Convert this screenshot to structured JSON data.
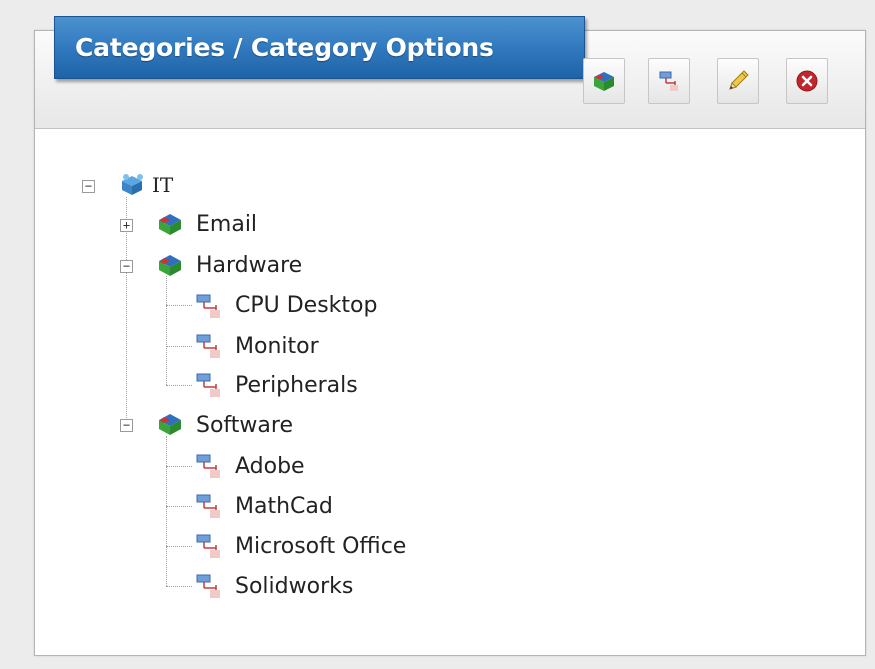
{
  "panel": {
    "title": "Categories / Category Options"
  },
  "toolbar": {
    "buttons": [
      {
        "name": "add-category",
        "icon": "category-cube-icon"
      },
      {
        "name": "add-option",
        "icon": "option-connector-icon"
      },
      {
        "name": "edit",
        "icon": "pencil-icon"
      },
      {
        "name": "delete",
        "icon": "delete-red-x-icon"
      }
    ]
  },
  "tree": {
    "root": {
      "label": "IT",
      "expanded": true,
      "icon": "network-root-icon"
    },
    "categories": [
      {
        "label": "Email",
        "expanded": false,
        "icon": "category-cube-icon",
        "options": []
      },
      {
        "label": "Hardware",
        "expanded": true,
        "icon": "category-cube-icon",
        "options": [
          "CPU Desktop",
          "Monitor",
          "Peripherals"
        ]
      },
      {
        "label": "Software",
        "expanded": true,
        "icon": "category-cube-icon",
        "options": [
          "Adobe",
          "MathCad",
          "Microsoft Office",
          "Solidworks"
        ]
      }
    ],
    "expander_symbols": {
      "expanded": "−",
      "collapsed": "+"
    }
  },
  "colors": {
    "title_bar": "#2f77bd",
    "panel_border": "#b4b4b4",
    "delete_red": "#c0262c",
    "cube_green": "#3aa53a",
    "cube_red": "#d2322d",
    "cube_blue": "#2f6fc0"
  }
}
